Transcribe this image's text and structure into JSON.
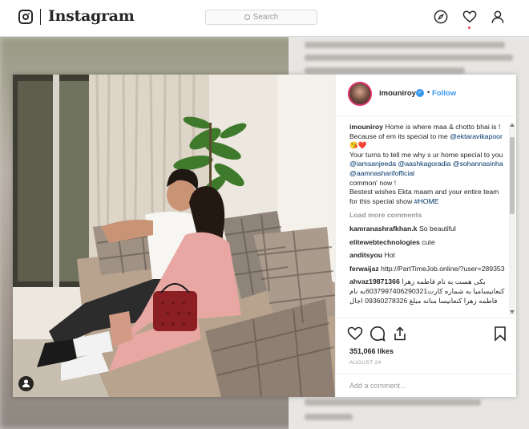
{
  "nav": {
    "brand": "Instagram",
    "search_placeholder": "Search",
    "icons": [
      "instagram-logo-icon",
      "compass-icon",
      "heart-icon",
      "user-icon"
    ],
    "notification_color": "#ed4956"
  },
  "post": {
    "username": "imouniroy",
    "verified": true,
    "follow_label": "Follow",
    "dot": "•",
    "caption": {
      "user": "imouniroy",
      "text1": "Home is where maa & chotto bhai is ! Because of em its special to me",
      "mention1": "@ektaravikapoor",
      "emoji": "😘❤️",
      "text2": "Your turns to tell me why s ur home special to you",
      "mention2": "@iamsanjeeda",
      "mention3": "@aashkagoradia",
      "mention4": "@sohannasinha",
      "mention5": "@aamnasharifofficial",
      "text3": "common' now !",
      "text4": "Bestest wishes Ekta maam and your entire team for this special show",
      "hashtag": "#HOME"
    },
    "load_more": "Load more comments",
    "comments": [
      {
        "user": "kamranashrafkhan.k",
        "text": "So beautiful"
      },
      {
        "user": "elitewebtechnologies",
        "text": "cute"
      },
      {
        "user": "anditsyou",
        "text": "Hot"
      },
      {
        "user": "ferwaijaz",
        "text": "http://PartTimeJob.online/?user=289353"
      },
      {
        "user": "ahvaz19871366",
        "text": "یکی هست به نام فاطمه زهرا کنعانیسامیا به شماره کارت6037997406290321به نام فاطمه زهرا کنعانیسا منانه مبلغ 09360278326 اجال"
      }
    ],
    "likes": "351,066 likes",
    "date": "AUGUST 24",
    "add_comment_placeholder": "Add a comment...",
    "action_icons": [
      "heart-outline-icon",
      "comment-icon",
      "share-icon",
      "bookmark-icon"
    ]
  },
  "colors": {
    "link": "#003569",
    "accent": "#3897f0",
    "muted": "#999999",
    "text": "#262626"
  }
}
